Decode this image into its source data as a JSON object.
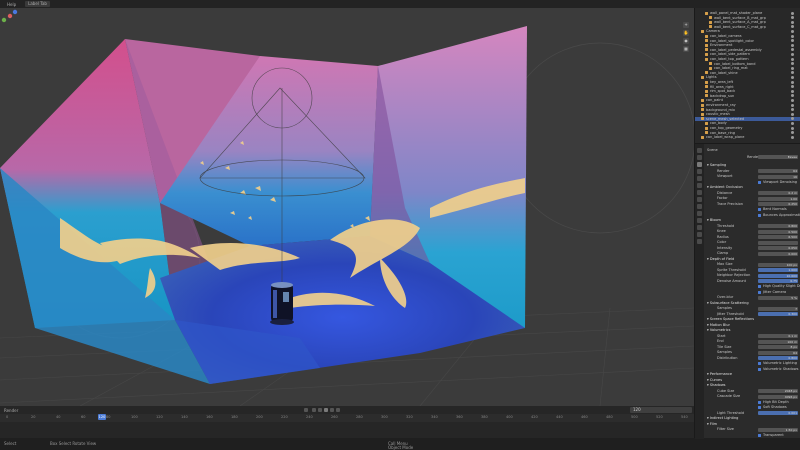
{
  "topbar": {
    "menu": [
      "Help"
    ],
    "tab": "Label Tab"
  },
  "timeline": {
    "header_label": "Render",
    "current_frame": "120",
    "ticks": [
      "0",
      "20",
      "40",
      "60",
      "80",
      "100",
      "120",
      "140",
      "160",
      "180",
      "200",
      "220",
      "240",
      "260",
      "280",
      "300",
      "320",
      "340",
      "360",
      "380",
      "400",
      "420",
      "440",
      "460",
      "480",
      "500",
      "520",
      "540"
    ]
  },
  "outliner": {
    "rows": [
      {
        "label": "wall_panel_mat_shader_plane",
        "depth": 2
      },
      {
        "label": "wall_bent_surface_B_mat_grp",
        "depth": 3
      },
      {
        "label": "wall_bent_surface_A_mat_grp",
        "depth": 3
      },
      {
        "label": "wall_bent_surface_C_mat_grp",
        "depth": 3
      },
      {
        "label": "Camera",
        "depth": 1
      },
      {
        "label": "can_label_camera",
        "depth": 2
      },
      {
        "label": "can_label_spotlight_color",
        "depth": 2
      },
      {
        "label": "Environment",
        "depth": 2
      },
      {
        "label": "can_label_pedestal_assembly",
        "depth": 2
      },
      {
        "label": "can_label_side_pattern",
        "depth": 2
      },
      {
        "label": "can_label_top_pattern",
        "depth": 2
      },
      {
        "label": "can_label_bottom_band",
        "depth": 3
      },
      {
        "label": "can_label_ring_mat",
        "depth": 3
      },
      {
        "label": "can_label_shine",
        "depth": 2
      },
      {
        "label": "Lights",
        "depth": 1
      },
      {
        "label": "key_area_left",
        "depth": 2
      },
      {
        "label": "fill_area_right",
        "depth": 2
      },
      {
        "label": "rim_spot_back",
        "depth": 2
      },
      {
        "label": "backdrop_sun",
        "depth": 2
      },
      {
        "label": "can_paint",
        "depth": 1
      },
      {
        "label": "environment_ray",
        "depth": 1
      },
      {
        "label": "background_mix",
        "depth": 1
      },
      {
        "label": "caustic_mesh",
        "depth": 1
      },
      {
        "label": "scene_mesh_selected",
        "depth": 1,
        "selected": true
      },
      {
        "label": "can_body",
        "depth": 2
      },
      {
        "label": "can_top_geometry",
        "depth": 2
      },
      {
        "label": "can_base_ring",
        "depth": 2
      },
      {
        "label": "can_label_wrap_plane",
        "depth": 1
      }
    ]
  },
  "properties": {
    "header": "Scene",
    "render_engine_label": "Render Engine",
    "render_engine_value": "Eevee",
    "rows": [
      {
        "label": "Sampling",
        "section": true
      },
      {
        "label": "Render",
        "value": "64"
      },
      {
        "label": "Viewport",
        "value": "16"
      },
      {
        "label": "Viewport Denoising",
        "check": true
      },
      {
        "label": "Ambient Occlusion",
        "section": true
      },
      {
        "label": "Distance",
        "value": "0.2 m"
      },
      {
        "label": "Factor",
        "value": "1.00"
      },
      {
        "label": "Trace Precision",
        "value": "0.250"
      },
      {
        "label": "Bent Normals",
        "check": true
      },
      {
        "label": "Bounces Approximation",
        "check": true
      },
      {
        "label": "Bloom",
        "section": true
      },
      {
        "label": "Threshold",
        "value": "0.800"
      },
      {
        "label": "Knee",
        "value": "0.500"
      },
      {
        "label": "Radius",
        "value": "6.500"
      },
      {
        "label": "Color",
        "value": ""
      },
      {
        "label": "Intensity",
        "value": "0.050"
      },
      {
        "label": "Clamp",
        "value": "0.000"
      },
      {
        "label": "Depth of Field",
        "section": true
      },
      {
        "label": "Max Size",
        "value": "100 px"
      },
      {
        "label": "Sprite Threshold",
        "value": "1.000",
        "blue": true
      },
      {
        "label": "Neighbor Rejection",
        "value": "10.000",
        "blue": true
      },
      {
        "label": "Denoise Amount",
        "value": "0.75",
        "blue": true
      },
      {
        "label": "High Quality Slight Defocus",
        "check": true
      },
      {
        "label": "Jitter Camera",
        "check": true
      },
      {
        "label": "Over-blur",
        "value": "5 %"
      },
      {
        "label": "Subsurface Scattering",
        "section": true
      },
      {
        "label": "Samples",
        "value": "7"
      },
      {
        "label": "Jitter Threshold",
        "value": "0.300",
        "blue": true
      },
      {
        "label": "Screen Space Reflections",
        "section": true
      },
      {
        "label": "Motion Blur",
        "section": true
      },
      {
        "label": "Volumetrics",
        "section": true
      },
      {
        "label": "Start",
        "value": "0.1 m"
      },
      {
        "label": "End",
        "value": "100 m"
      },
      {
        "label": "Tile Size",
        "value": "8 px"
      },
      {
        "label": "Samples",
        "value": "64"
      },
      {
        "label": "Distribution",
        "value": "0.800",
        "blue": true
      },
      {
        "label": "Volumetric Lighting",
        "check": true
      },
      {
        "label": "Volumetric Shadows",
        "check": true
      },
      {
        "label": "Performance",
        "section": true
      },
      {
        "label": "Curves",
        "section": true
      },
      {
        "label": "Shadows",
        "section": true
      },
      {
        "label": "Cube Size",
        "value": "2048 px"
      },
      {
        "label": "Cascade Size",
        "value": "4096 px"
      },
      {
        "label": "High Bit Depth",
        "check": true
      },
      {
        "label": "Soft Shadows",
        "check": true
      },
      {
        "label": "Light Threshold",
        "value": "0.001",
        "blue": true
      },
      {
        "label": "Indirect Lighting",
        "section": true
      },
      {
        "label": "Film",
        "section": true
      },
      {
        "label": "Filter Size",
        "value": "1.50 px"
      },
      {
        "label": "Transparent",
        "check": true
      }
    ]
  },
  "statusbar": {
    "left": "Select",
    "left2": "Box Select   Rotate View",
    "mid": "Call Menu",
    "mid2": "Object Mode"
  },
  "colors": {
    "accent": "#4b7bd6",
    "wall_pink": "#d77fb2",
    "wall_cyan": "#1fa6cf",
    "floor_blue": "#2b4bd0",
    "splash": "#f2cf8a"
  }
}
